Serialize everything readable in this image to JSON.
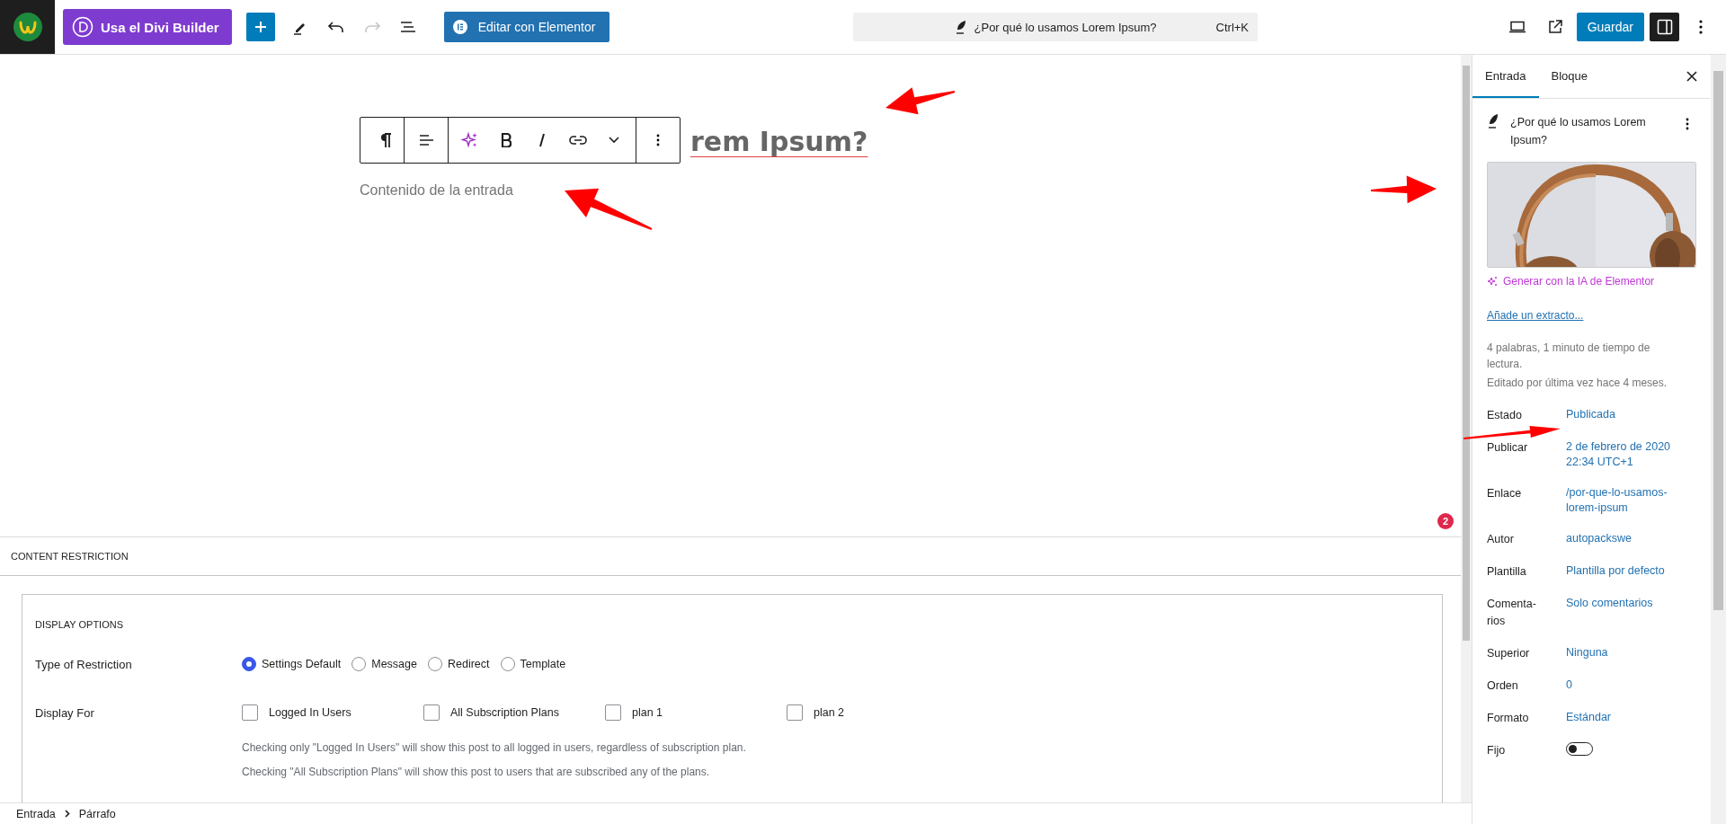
{
  "top_bar": {
    "divi_button": "Usa el Divi Builder",
    "tools": [
      {
        "kind": "add",
        "disabled": false
      },
      {
        "kind": "pen",
        "disabled": false
      },
      {
        "kind": "undo",
        "disabled": false
      },
      {
        "kind": "redo",
        "disabled": true
      },
      {
        "kind": "outline",
        "disabled": false
      }
    ],
    "elementor_button": "Editar con Elementor",
    "command_bar": {
      "title": "¿Por qué lo usamos Lorem Ipsum?",
      "shortcut": "Ctrl+K"
    },
    "save_button": "Guardar",
    "settings_open": true
  },
  "editor": {
    "title_visible": "rem Ipsum?",
    "toolbar": [
      {
        "kind": "paragraph"
      },
      {
        "kind": "align"
      },
      {
        "kind": "ai"
      },
      {
        "kind": "bold"
      },
      {
        "kind": "italic"
      },
      {
        "kind": "link"
      },
      {
        "kind": "more"
      },
      {
        "kind": "options"
      }
    ],
    "paragraph_placeholder": "Contenido de la entrada",
    "notification_count": "2"
  },
  "content_restriction": {
    "title": "CONTENT RESTRICTION",
    "section_title": "DISPLAY OPTIONS",
    "type_label": "Type of Restriction",
    "types": [
      {
        "label": "Settings Default",
        "selected": true
      },
      {
        "label": "Message",
        "selected": false
      },
      {
        "label": "Redirect",
        "selected": false
      },
      {
        "label": "Template",
        "selected": false
      }
    ],
    "display_label": "Display For",
    "display_options": [
      {
        "label": "Logged In Users",
        "checked": false
      },
      {
        "label": "All Subscription Plans",
        "checked": false
      },
      {
        "label": "plan 1",
        "checked": false
      },
      {
        "label": "plan 2",
        "checked": false
      }
    ],
    "help": [
      "Checking only \"Logged In Users\" will show this post to all logged in users, regardless of subscription plan.",
      "Checking \"All Subscription Plans\" will show this post to users that are subscribed any of the plans."
    ]
  },
  "sidebar": {
    "tabs": [
      {
        "label": "Entrada",
        "selected": true
      },
      {
        "label": "Bloque",
        "selected": false
      }
    ],
    "post_title": "¿Por qué lo usamos Lorem Ipsum?",
    "ai_link": "Generar con la IA de Elementor",
    "excerpt_link": "Añade un extracto...",
    "stats": [
      "4 palabras, 1 minuto de tiempo de lectura.",
      "Editado por última vez hace 4 meses."
    ],
    "fields": [
      {
        "label": "Estado",
        "kind": "link",
        "value": "Publicada"
      },
      {
        "label": "Publicar",
        "kind": "link",
        "value": "2 de febrero de 2020 22:34 UTC+1"
      },
      {
        "label": "Enlace",
        "kind": "link",
        "value": "/por-que-lo-usamos-lorem-ipsum"
      },
      {
        "label": "Autor",
        "kind": "link",
        "value": "autopackswe"
      },
      {
        "label": "Plantilla",
        "kind": "link",
        "value": "Plantilla por defecto"
      },
      {
        "label": "Comenta-rios",
        "kind": "link",
        "value": "Solo comentarios"
      },
      {
        "label": "Superior",
        "kind": "link",
        "value": "Ninguna"
      },
      {
        "label": "Orden",
        "kind": "link",
        "value": "0"
      },
      {
        "label": "Formato",
        "kind": "link",
        "value": "Estándar"
      },
      {
        "label": "Fijo",
        "kind": "toggle",
        "on": false
      }
    ]
  },
  "breadcrumb": [
    "Entrada",
    "Párrafo"
  ]
}
